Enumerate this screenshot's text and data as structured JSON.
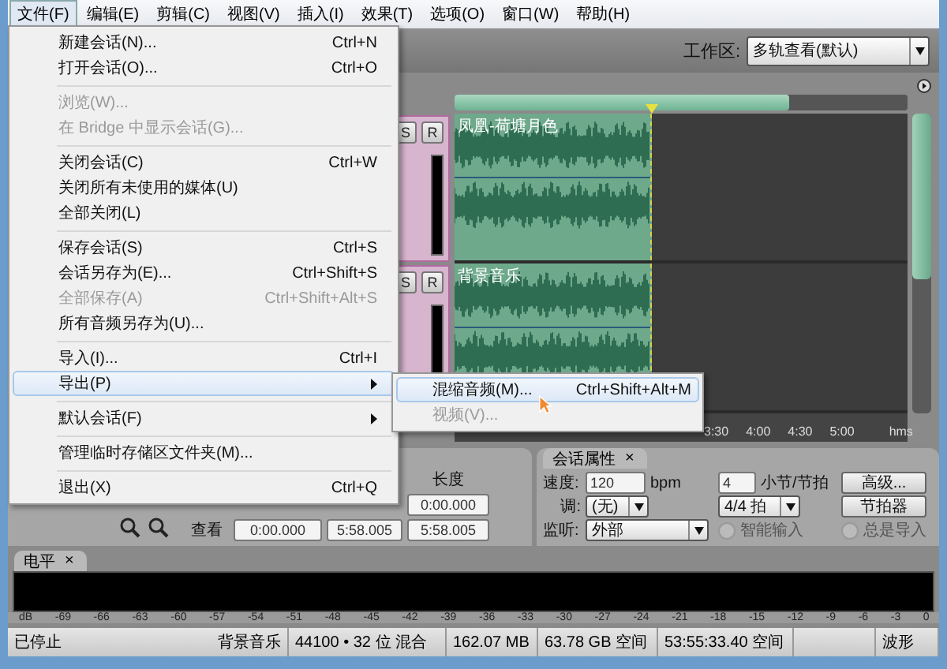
{
  "menu_bar": [
    {
      "label": "文件(F)",
      "selected": true
    },
    {
      "label": "编辑(E)",
      "selected": false
    },
    {
      "label": "剪辑(C)",
      "selected": false
    },
    {
      "label": "视图(V)",
      "selected": false
    },
    {
      "label": "插入(I)",
      "selected": false
    },
    {
      "label": "效果(T)",
      "selected": false
    },
    {
      "label": "选项(O)",
      "selected": false
    },
    {
      "label": "窗口(W)",
      "selected": false
    },
    {
      "label": "帮助(H)",
      "selected": false
    }
  ],
  "toolbar": {
    "workspace_label": "工作区:",
    "workspace": "多轨查看(默认)"
  },
  "tracks": [
    {
      "solo": "S",
      "record": "R",
      "clip": "凤凰-荷塘月色"
    },
    {
      "solo": "S",
      "record": "R",
      "clip": "背景音乐"
    }
  ],
  "ruler": [
    "3:30",
    "4:00",
    "4:30",
    "5:00"
  ],
  "ruler_unit": "hms",
  "selection_view": {
    "length_header": "长度",
    "selection_length": "0:00.000",
    "view_label": "查看",
    "view_start": "0:00.000",
    "view_end": "5:58.005",
    "view_length": "5:58.005"
  },
  "session_properties": {
    "tab": "会话属性",
    "close": "×",
    "tempo_label": "速度:",
    "tempo": "120",
    "tempo_unit": "bpm",
    "beats": "4",
    "beats_label": "小节/节拍",
    "advanced_button": "高级...",
    "key_label": "调:",
    "key": "(无)",
    "time_signature": "4/4 拍",
    "metronome_button": "节拍器",
    "monitor_label": "监听:",
    "monitor": "外部",
    "options": [
      {
        "label": "智能输入",
        "checked": false,
        "disabled": true
      },
      {
        "label": "总是导入",
        "checked": false,
        "disabled": true
      }
    ]
  },
  "levels": {
    "tab": "电平",
    "close": "×",
    "scale": [
      "dB",
      "-69",
      "-66",
      "-63",
      "-60",
      "-57",
      "-54",
      "-51",
      "-48",
      "-45",
      "-42",
      "-39",
      "-36",
      "-33",
      "-30",
      "-27",
      "-24",
      "-21",
      "-18",
      "-15",
      "-12",
      "-9",
      "-6",
      "-3",
      "0"
    ]
  },
  "status_bar": {
    "state": "已停止",
    "session": "背景音乐",
    "format": "44100 • 32 位 混合",
    "size": "162.07 MB",
    "disk": "63.78 GB 空间",
    "time": "53:55:33.40 空间",
    "view": "波形"
  },
  "file_menu": {
    "groups": [
      {
        "items": [
          {
            "label": "新建会话(N)...",
            "shortcut": "Ctrl+N",
            "disabled": false,
            "selected": false,
            "submenu": false
          },
          {
            "label": "打开会话(O)...",
            "shortcut": "Ctrl+O",
            "disabled": false,
            "selected": false,
            "submenu": false
          }
        ]
      },
      {
        "items": [
          {
            "label": "浏览(W)...",
            "disabled": true,
            "selected": false,
            "submenu": false
          },
          {
            "label": "在 Bridge 中显示会话(G)...",
            "disabled": true,
            "selected": false,
            "submenu": false
          }
        ]
      },
      {
        "items": [
          {
            "label": "关闭会话(C)",
            "shortcut": "Ctrl+W",
            "disabled": false,
            "selected": false,
            "submenu": false
          },
          {
            "label": "关闭所有未使用的媒体(U)",
            "disabled": false,
            "selected": false,
            "submenu": false
          },
          {
            "label": "全部关闭(L)",
            "disabled": false,
            "selected": false,
            "submenu": false
          }
        ]
      },
      {
        "items": [
          {
            "label": "保存会话(S)",
            "shortcut": "Ctrl+S",
            "disabled": false,
            "selected": false,
            "submenu": false
          },
          {
            "label": "会话另存为(E)...",
            "shortcut": "Ctrl+Shift+S",
            "disabled": false,
            "selected": false,
            "submenu": false
          },
          {
            "label": "全部保存(A)",
            "shortcut": "Ctrl+Shift+Alt+S",
            "disabled": true,
            "selected": false,
            "submenu": false
          },
          {
            "label": "所有音频另存为(U)...",
            "disabled": false,
            "selected": false,
            "submenu": false
          }
        ]
      },
      {
        "items": [
          {
            "label": "导入(I)...",
            "shortcut": "Ctrl+I",
            "disabled": false,
            "selected": false,
            "submenu": false
          },
          {
            "label": "导出(P)",
            "disabled": false,
            "selected": true,
            "submenu": true
          }
        ]
      },
      {
        "items": [
          {
            "label": "默认会话(F)",
            "disabled": false,
            "selected": false,
            "submenu": true
          }
        ]
      },
      {
        "items": [
          {
            "label": "管理临时存储区文件夹(M)...",
            "disabled": false,
            "selected": false,
            "submenu": false
          }
        ]
      },
      {
        "items": [
          {
            "label": "退出(X)",
            "shortcut": "Ctrl+Q",
            "disabled": false,
            "selected": false,
            "submenu": false
          }
        ]
      }
    ]
  },
  "export_submenu": [
    {
      "label": "混缩音频(M)...",
      "shortcut": "Ctrl+Shift+Alt+M",
      "disabled": false,
      "selected": true
    },
    {
      "label": "视频(V)...",
      "disabled": true,
      "selected": false
    }
  ]
}
